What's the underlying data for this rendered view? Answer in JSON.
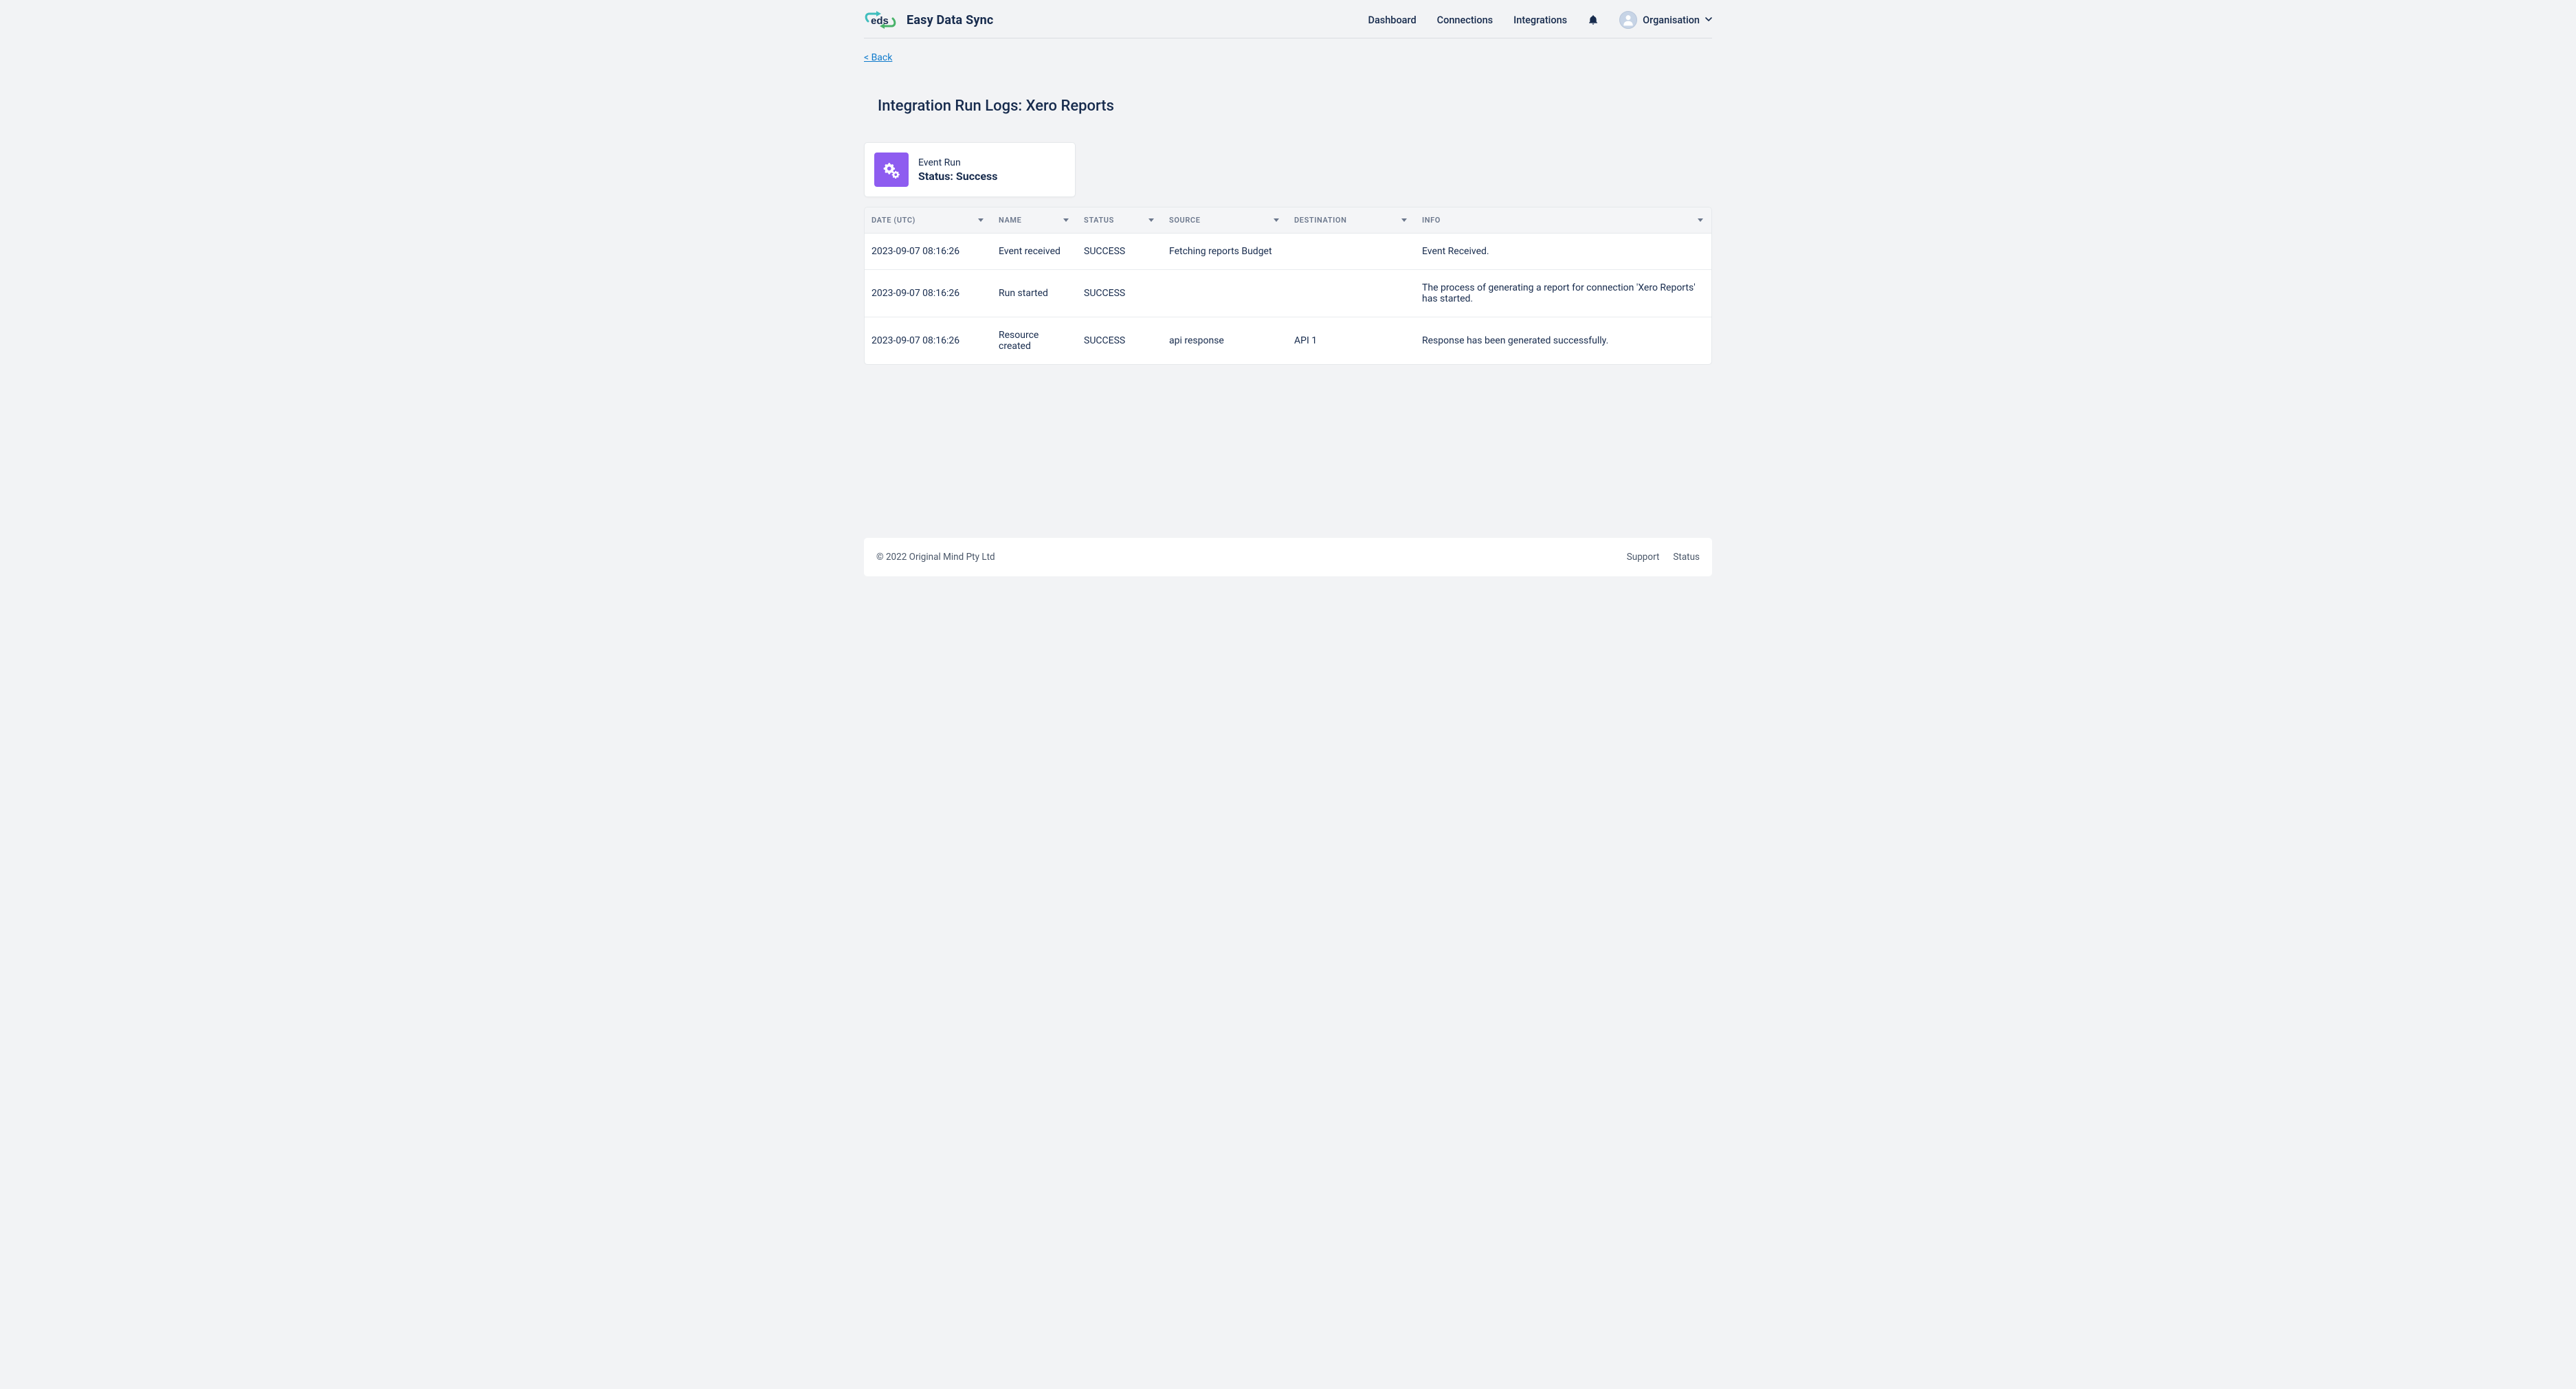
{
  "header": {
    "brand": "Easy Data Sync",
    "nav": {
      "dashboard": "Dashboard",
      "connections": "Connections",
      "integrations": "Integrations"
    },
    "org_label": "Organisation"
  },
  "back_link": "< Back",
  "page_title": "Integration Run Logs: Xero Reports",
  "status_card": {
    "label": "Event Run",
    "value": "Status: Success"
  },
  "table": {
    "columns": {
      "date": "DATE (UTC)",
      "name": "NAME",
      "status": "STATUS",
      "source": "SOURCE",
      "destination": "DESTINATION",
      "info": "INFO"
    },
    "rows": [
      {
        "date": "2023-09-07 08:16:26",
        "name": "Event received",
        "status": "SUCCESS",
        "source": "Fetching reports Budget",
        "destination": "",
        "info": "Event Received."
      },
      {
        "date": "2023-09-07 08:16:26",
        "name": "Run started",
        "status": "SUCCESS",
        "source": "",
        "destination": "",
        "info": "The process of generating a report for connection 'Xero Reports' has started."
      },
      {
        "date": "2023-09-07 08:16:26",
        "name": "Resource created",
        "status": "SUCCESS",
        "source": "api response",
        "destination": "API 1",
        "info": "Response has been generated successfully."
      }
    ]
  },
  "footer": {
    "copyright": "© 2022 Original Mind Pty Ltd",
    "support": "Support",
    "status": "Status"
  }
}
